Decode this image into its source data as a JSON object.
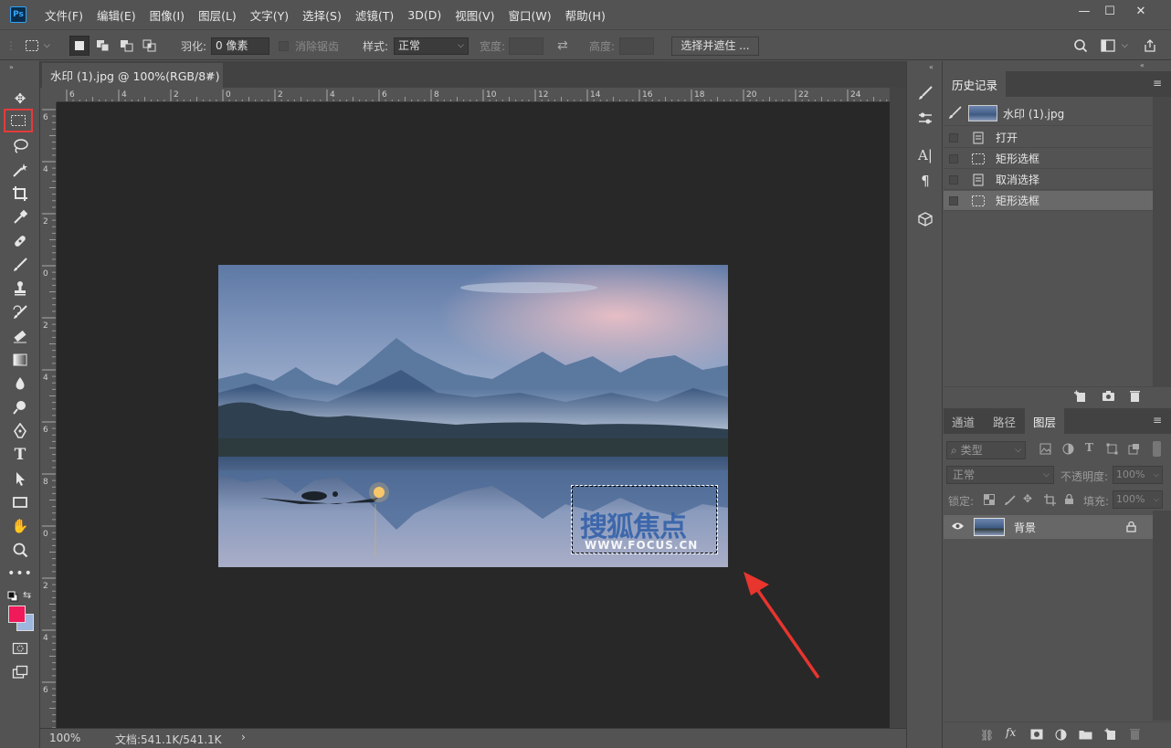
{
  "app": {
    "logo": "Ps"
  },
  "menu": [
    "文件(F)",
    "编辑(E)",
    "图像(I)",
    "图层(L)",
    "文字(Y)",
    "选择(S)",
    "滤镜(T)",
    "3D(D)",
    "视图(V)",
    "窗口(W)",
    "帮助(H)"
  ],
  "window_controls": {
    "minimize": "—",
    "maximize": "☐",
    "close": "✕"
  },
  "options": {
    "feather_label": "羽化:",
    "feather_value": "0 像素",
    "antialias_label": "消除锯齿",
    "style_label": "样式:",
    "style_value": "正常",
    "width_label": "宽度:",
    "height_label": "高度:",
    "select_mask_button": "选择并遮住 ..."
  },
  "document": {
    "tab_title": "水印 (1).jpg @ 100%(RGB/8#)",
    "tab_close": "×",
    "ruler_h_labels": [
      "6",
      "4",
      "2",
      "0",
      "2",
      "4",
      "6",
      "8",
      "10",
      "12",
      "14",
      "16",
      "18",
      "20",
      "22",
      "24"
    ],
    "ruler_v_labels": [
      "6",
      "4",
      "2",
      "0",
      "2",
      "4",
      "6",
      "8",
      "0",
      "2",
      "4",
      "6"
    ],
    "zoom": "100%",
    "doc_info": "文档:541.1K/541.1K",
    "status_arrow": "›",
    "watermark_text": "搜狐焦点",
    "watermark_url": "WWW.FOCUS.CN"
  },
  "history_panel": {
    "tab": "历史记录",
    "snapshot_name": "水印 (1).jpg",
    "items": [
      "打开",
      "矩形选框",
      "取消选择",
      "矩形选框"
    ]
  },
  "layers_panel": {
    "tabs": [
      "通道",
      "路径",
      "图层"
    ],
    "filter_placeholder": "类型",
    "blend_mode": "正常",
    "opacity_label": "不透明度:",
    "opacity_value": "100%",
    "lock_label": "锁定:",
    "fill_label": "填充:",
    "fill_value": "100%",
    "layers": [
      {
        "name": "背景"
      }
    ],
    "fx_label": "fx"
  },
  "colors": {
    "foreground": "#f0195a",
    "background": "#9db6dd",
    "highlight": "#e53a3a",
    "arrow": "#e8352e"
  }
}
